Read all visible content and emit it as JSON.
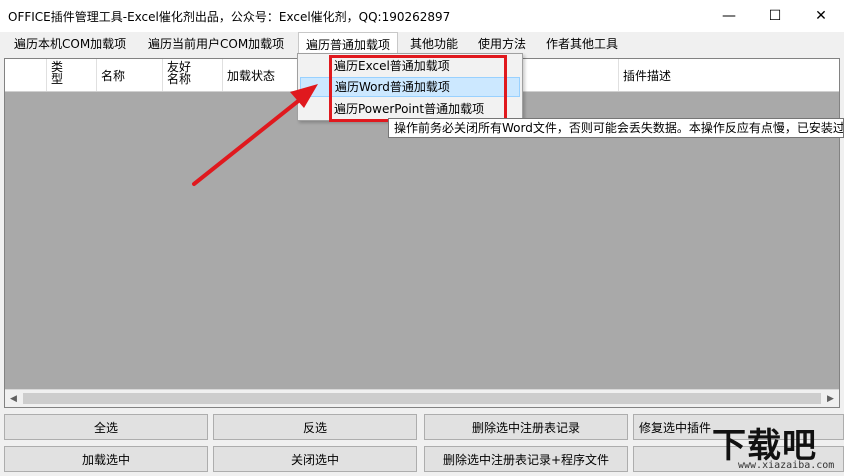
{
  "window": {
    "title": "OFFICE插件管理工具-Excel催化剂出品，公众号：Excel催化剂，QQ:190262897",
    "minimize": "—",
    "maximize": "☐",
    "close": "✕"
  },
  "menu": {
    "items": [
      {
        "label": "遍历本机COM加载项"
      },
      {
        "label": "遍历当前用户COM加载项"
      },
      {
        "label": "遍历普通加载项"
      },
      {
        "label": "其他功能"
      },
      {
        "label": "使用方法"
      },
      {
        "label": "作者其他工具"
      }
    ]
  },
  "dropdown": {
    "items": [
      {
        "label": "遍历Excel普通加载项"
      },
      {
        "label": "遍历Word普通加载项"
      },
      {
        "label": "遍历PowerPoint普通加载项"
      }
    ]
  },
  "tooltip": "操作前务必关闭所有Word文件，否则可能会丢失数据。本操作反应有点慢，已安装过",
  "table": {
    "headers": [
      "类型",
      "名称",
      "友好名称",
      "加载状态",
      "插件描述"
    ]
  },
  "buttons": {
    "select_all": "全选",
    "invert": "反选",
    "delete_reg": "删除选中注册表记录",
    "repair": "修复选中插件",
    "load_selected": "加载选中",
    "close_selected": "关闭选中",
    "delete_reg_files": "删除选中注册表记录+程序文件"
  },
  "watermark": {
    "main": "下载吧",
    "sub": "www.xiazaiba.com"
  },
  "colors": {
    "highlight": "#e0191e",
    "menu_hover": "#cce8ff"
  }
}
